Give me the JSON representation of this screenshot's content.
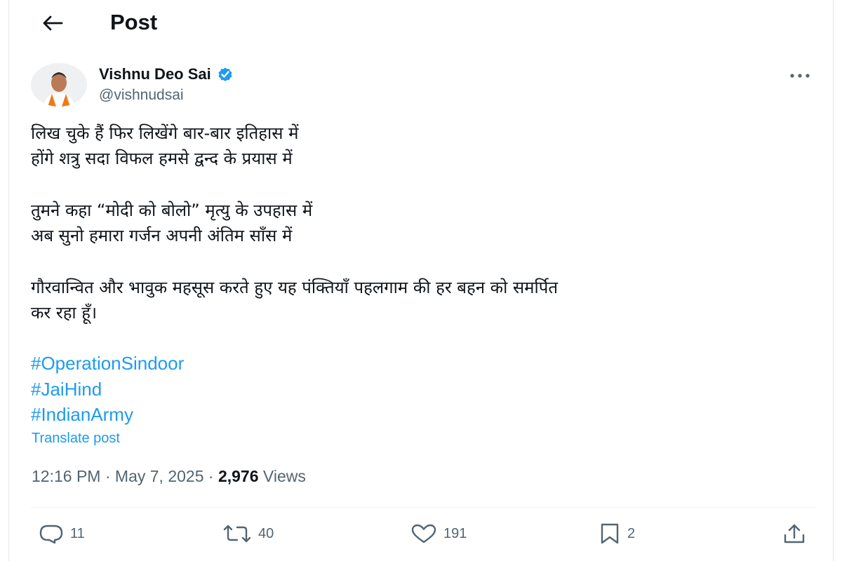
{
  "header": {
    "title": "Post",
    "back_icon": "arrow-left-icon"
  },
  "author": {
    "display_name": "Vishnu Deo Sai",
    "handle": "@vishnudsai",
    "verified": true,
    "verified_color": "#1d9bf0"
  },
  "post": {
    "lines_1": [
      "लिख चुके हैं फिर लिखेंगे बार-बार इतिहास में",
      "होंगे शत्रु सदा विफल हमसे द्वन्द के प्रयास में"
    ],
    "lines_2": [
      "तुमने कहा “मोदी को बोलो” मृत्यु के उपहास में",
      "अब सुनो हमारा गर्जन अपनी अंतिम साँस में"
    ],
    "lines_3": [
      "गौरवान्वित और भावुक महसूस करते हुए यह पंक्तियाँ पहलगाम की हर बहन को समर्पित",
      "कर रहा हूँ।"
    ],
    "hashtags": [
      "#OperationSindoor",
      "#JaiHind",
      "#IndianArmy"
    ],
    "translate_label": "Translate post",
    "link_color": "#1d9bf0"
  },
  "meta": {
    "time": "12:16 PM",
    "separator": " · ",
    "date": "May 7, 2025",
    "views_count": "2,976",
    "views_label": "Views"
  },
  "actions": {
    "reply_count": "11",
    "repost_count": "40",
    "like_count": "191",
    "bookmark_count": "2",
    "icons": [
      "reply-icon",
      "repost-icon",
      "like-icon",
      "bookmark-icon",
      "share-icon"
    ]
  }
}
